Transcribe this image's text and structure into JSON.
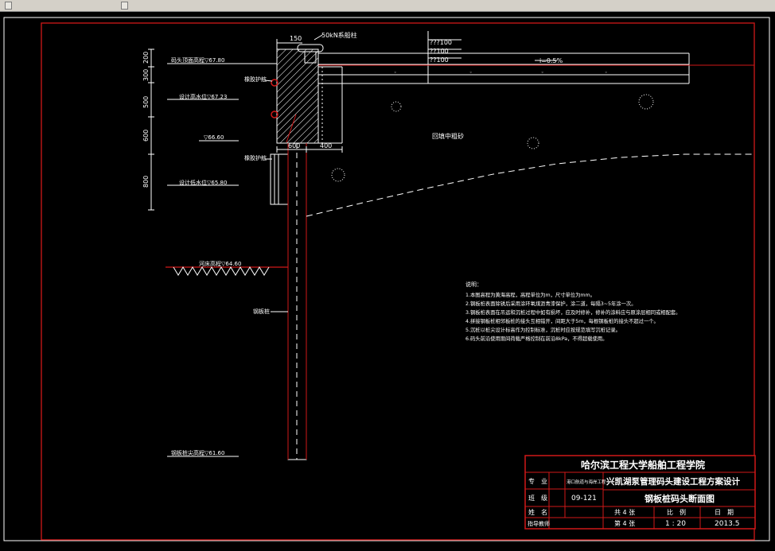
{
  "window": {
    "background": "#000000",
    "frame_color": "#d01818",
    "line_color": "#ffffff",
    "fill_color": "#c80000"
  },
  "section": {
    "dims": {
      "top_width": "150",
      "base_width": "600",
      "apron_width": "400",
      "h1": "200",
      "h2": "300",
      "h3": "500",
      "h4": "600",
      "h5": "800"
    },
    "bollard_label": "50kN系船柱",
    "pavement": [
      "???100",
      "??100",
      "??100"
    ],
    "slope": "i=0.5%",
    "backfill": "回填中粗砂",
    "fender_upper": "橡胶护舷",
    "fender_lower": "橡胶护舷",
    "sheet_pile": "钢板桩"
  },
  "elevations": {
    "top": "码头顶面高程▽67.80",
    "design_high": "设计高水位▽67.23",
    "mid": "▽66.60",
    "design_low": "设计低水位▽65.80",
    "riverbed": "河床高程▽64.60",
    "toe": "钢板桩尖高程▽61.60"
  },
  "notes": {
    "heading": "说明：",
    "items": [
      "1.本图高程为黄海高程，高程单位为m，尺寸单位为mm。",
      "2.钢板桩表面除锈后采用涂环氧煤沥青漆保护，涂二道，每隔3~5年涂一次。",
      "3.钢板桩表面在吊运和沉桩过程中如有损坏，应及时修补，修补的涂料应与原涂层相同或相配套。",
      "4.拼接钢板桩相邻板桩的接头互相错开，间距大于5m，每根钢板桩的接头不超过一个。",
      "5.沉桩以桩尖设计标高作为控制标准，沉桩时应按规范填写沉桩记录。",
      "6.码头前沿使用期间荷载严格控制在前沿8kPa，不得超载使用。"
    ]
  },
  "title_block": {
    "school": "哈尔滨工程大学船舶工程学院",
    "major_label": "专　业",
    "major_value": "港口航道与海岸工程",
    "project": "兴凯湖泵管理码头建设工程方案设计",
    "class_label": "班　级",
    "class_value": "09-121",
    "drawing_name": "钢板桩码头断面图",
    "name_label": "姓　名",
    "total_label": "共 4 张",
    "scale_label": "比　例",
    "date_label": "日　期",
    "advisor_label": "指导教师",
    "sheet_label": "第 4 张",
    "scale_value": "1 : 20",
    "date_value": "2013.5"
  }
}
